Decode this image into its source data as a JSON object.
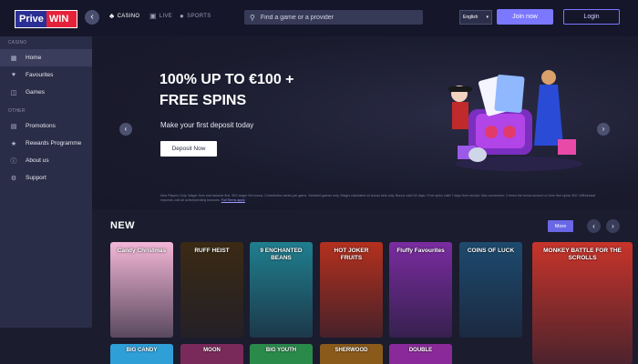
{
  "brand": {
    "part1": "Prive",
    "part2": "WIN"
  },
  "top_nav": [
    {
      "label": "CASINO",
      "icon": "club-icon"
    },
    {
      "label": "LIVE",
      "icon": "live-icon"
    },
    {
      "label": "SPORTS",
      "icon": "ball-icon"
    }
  ],
  "search": {
    "placeholder": "Find a game or a provider"
  },
  "language": {
    "selected": "English"
  },
  "auth": {
    "join_label": "Join now",
    "login_label": "Login"
  },
  "sidebar": {
    "casino_label": "CASINO",
    "casino_items": [
      {
        "label": "Home",
        "icon": "home-icon",
        "active": true
      },
      {
        "label": "Favourites",
        "icon": "heart-icon"
      },
      {
        "label": "Games",
        "icon": "games-icon"
      }
    ],
    "other_label": "OTHER",
    "other_items": [
      {
        "label": "Promotions",
        "icon": "gift-icon"
      },
      {
        "label": "Rewards Programme",
        "icon": "trophy-icon"
      },
      {
        "label": "About us",
        "icon": "info-icon"
      },
      {
        "label": "Support",
        "icon": "support-icon"
      }
    ]
  },
  "banner": {
    "headline_line1": "100% UP TO €100 +",
    "headline_line2": "FREE SPINS",
    "subline": "Make your first deposit today",
    "cta_label": "Deposit Now",
    "terms": "New Players Only. Wager from real balance first. 50X wager the bonus. Contribution varies per game. Selected games only. Wager calculated on bonus bets only. Bonus valid 30 days / Free spins valid 7 days from receipt. Max conversion: 3 times the bonus amount or from free spins: €20. Withdrawal requests void all active/pending bonuses.",
    "terms_link": "Full Terms apply"
  },
  "new_section": {
    "title": "NEW",
    "more_label": "More",
    "games_row1": [
      {
        "title": "Candy Christmas",
        "bg": "#f3b6d6"
      },
      {
        "title": "RUFF HEIST",
        "bg": "#3b2a14"
      },
      {
        "title": "9 ENCHANTED BEANS",
        "bg": "#1f7f8f"
      },
      {
        "title": "HOT JOKER FRUITS",
        "bg": "#b4301e"
      },
      {
        "title": "Fluffy Favourites",
        "bg": "#7a2ca0"
      },
      {
        "title": "COINS OF LUCK",
        "bg": "#1d4a6e"
      },
      {
        "title": "MONKEY BATTLE FOR THE SCROLLS",
        "bg": "#c8342a"
      }
    ],
    "games_row2": [
      {
        "title": "BIG CANDY",
        "bg": "#2f9fd8"
      },
      {
        "title": "MOON",
        "bg": "#7a2a5a"
      },
      {
        "title": "BIG YOUTH",
        "bg": "#2a8a4a"
      },
      {
        "title": "SHERWOOD",
        "bg": "#8a5a1a"
      },
      {
        "title": "DOUBLE",
        "bg": "#8a2a9a"
      }
    ]
  }
}
